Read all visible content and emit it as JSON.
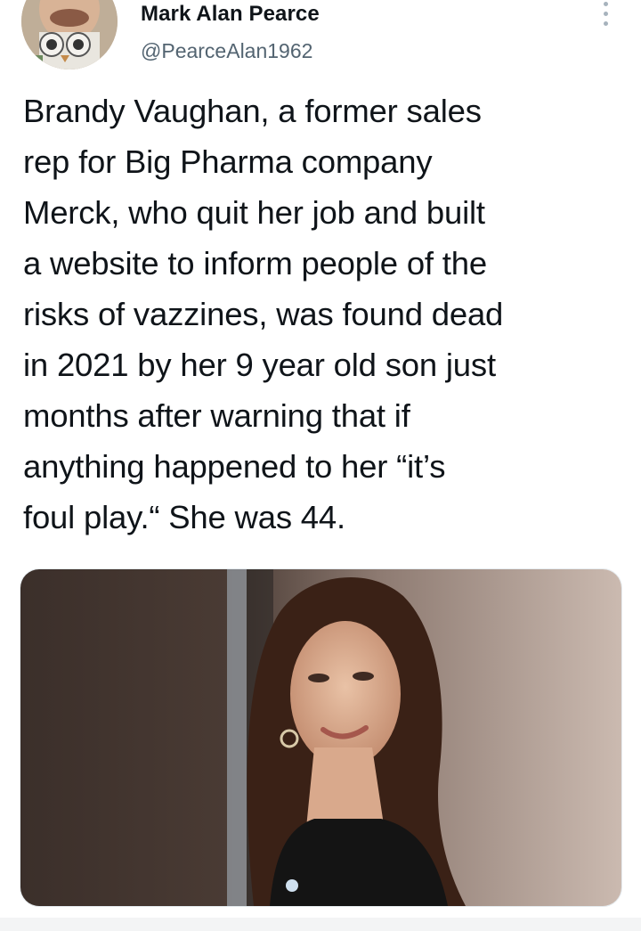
{
  "author": {
    "display_name": "Mark Alan Pearce",
    "handle": "@PearceAlan1962"
  },
  "tweet": {
    "text_lines": [
      "Brandy Vaughan, a former sales",
      "rep for Big Pharma company",
      "Merck, who quit her job and built",
      "a website to inform people of the",
      "risks of vazzines, was found dead",
      "in 2021 by her 9 year old son just",
      "months after warning that if",
      "anything happened to her “it’s",
      "foul play.“ She was 44."
    ]
  },
  "icons": {
    "more": "more-options-icon"
  },
  "colors": {
    "text_primary": "#0f1419",
    "text_secondary": "#536471",
    "background": "#ffffff"
  }
}
